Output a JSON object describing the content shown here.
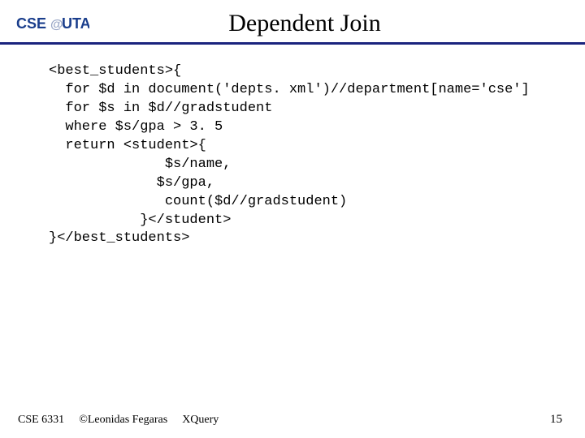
{
  "header": {
    "logo_cse": "CSE",
    "logo_uta": "UTA",
    "title": "Dependent Join"
  },
  "code": {
    "lines": [
      "<best_students>{",
      "  for $d in document('depts. xml')//department[name='cse']",
      "  for $s in $d//gradstudent",
      "  where $s/gpa > 3. 5",
      "  return <student>{",
      "              $s/name,",
      "             $s/gpa,",
      "              count($d//gradstudent)",
      "           }</student>",
      "}</best_students>"
    ]
  },
  "footer": {
    "course": "CSE 6331",
    "author": "©Leonidas Fegaras",
    "topic": "XQuery",
    "page": "15"
  }
}
